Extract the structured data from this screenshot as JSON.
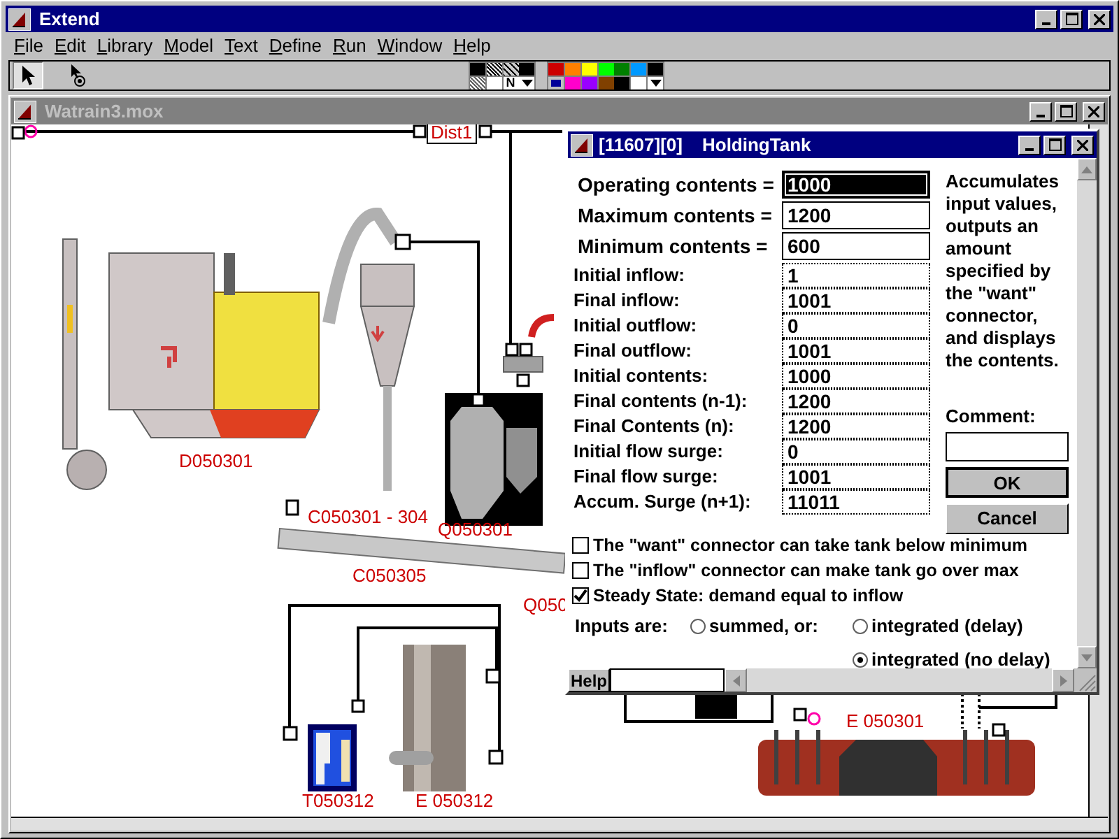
{
  "window": {
    "title": "Extend"
  },
  "menu": [
    {
      "label": "File"
    },
    {
      "label": "Edit"
    },
    {
      "label": "Library"
    },
    {
      "label": "Model"
    },
    {
      "label": "Text"
    },
    {
      "label": "Define"
    },
    {
      "label": "Run"
    },
    {
      "label": "Window"
    },
    {
      "label": "Help"
    }
  ],
  "toolbar": {
    "tools": [
      {
        "kind": "arrow",
        "selected": true
      },
      {
        "kind": "connector",
        "selected": false
      }
    ],
    "pattern_label": "N",
    "colors": [
      {
        "color": "#cc0000",
        "selected": false
      },
      {
        "color": "#ff8000",
        "selected": false
      },
      {
        "color": "#ffff00",
        "selected": false
      },
      {
        "color": "#00ff00",
        "selected": false
      },
      {
        "color": "#008000",
        "selected": false
      },
      {
        "color": "#0099ff",
        "selected": false
      },
      {
        "color": "#000000",
        "selected": false
      },
      {
        "color": "#000099",
        "selected": true
      },
      {
        "color": "#ff00cc",
        "selected": false
      },
      {
        "color": "#9900ff",
        "selected": false
      },
      {
        "color": "#804000",
        "selected": false
      },
      {
        "color": "#000000",
        "selected": false
      },
      {
        "color": "#ffffff",
        "selected": false
      }
    ]
  },
  "document": {
    "title": "Watrain3.mox",
    "labels": [
      "Dist1",
      "D050301",
      "C050301 - 304",
      "Q050301",
      "C050305",
      "Q050",
      "T050312",
      "E 050312",
      "E 050301"
    ]
  },
  "dialog": {
    "title_id": "[11607][0]",
    "title_name": "HoldingTank",
    "fields": [
      {
        "label": "Operating contents =",
        "value": "1000",
        "kind": "boxed",
        "selected": true
      },
      {
        "label": "Maximum contents =",
        "value": "1200",
        "kind": "boxed",
        "selected": false
      },
      {
        "label": "Minimum contents =",
        "value": "600",
        "kind": "boxed",
        "selected": false
      },
      {
        "label": "Initial inflow:",
        "value": "1",
        "kind": "dotted",
        "selected": false
      },
      {
        "label": "Final inflow:",
        "value": "1001",
        "kind": "dotted",
        "selected": false
      },
      {
        "label": "Initial outflow:",
        "value": "0",
        "kind": "dotted",
        "selected": false
      },
      {
        "label": "Final outflow:",
        "value": "1001",
        "kind": "dotted",
        "selected": false
      },
      {
        "label": "Initial contents:",
        "value": "1000",
        "kind": "dotted",
        "selected": false
      },
      {
        "label": "Final contents (n-1):",
        "value": "1200",
        "kind": "dotted",
        "selected": false
      },
      {
        "label": "Final Contents (n):",
        "value": "1200",
        "kind": "dotted",
        "selected": false
      },
      {
        "label": "Initial flow surge:",
        "value": "0",
        "kind": "dotted",
        "selected": false
      },
      {
        "label": "Final flow surge:",
        "value": "1001",
        "kind": "dotted",
        "selected": false
      },
      {
        "label": "Accum. Surge (n+1):",
        "value": "11011",
        "kind": "dotted",
        "selected": false
      }
    ],
    "description": "Accumulates input values, outputs an amount specified by the \"want\" connector, and displays the contents.",
    "comment_label": "Comment:",
    "buttons": [
      {
        "label": "OK",
        "default": true
      },
      {
        "label": "Cancel",
        "default": false
      }
    ],
    "checkboxes": [
      {
        "label": "The \"want\" connector can take tank below minimum",
        "checked": false
      },
      {
        "label": "The \"inflow\" connector can make tank go over max",
        "checked": false
      },
      {
        "label": "Steady State: demand equal to inflow",
        "checked": true
      }
    ],
    "inputs_label": "Inputs are:",
    "radios": [
      {
        "label": "summed, or:",
        "selected": false
      },
      {
        "label": "integrated (delay)",
        "selected": false
      },
      {
        "label": "integrated (no delay)",
        "selected": true
      }
    ],
    "help_button": "Help"
  }
}
